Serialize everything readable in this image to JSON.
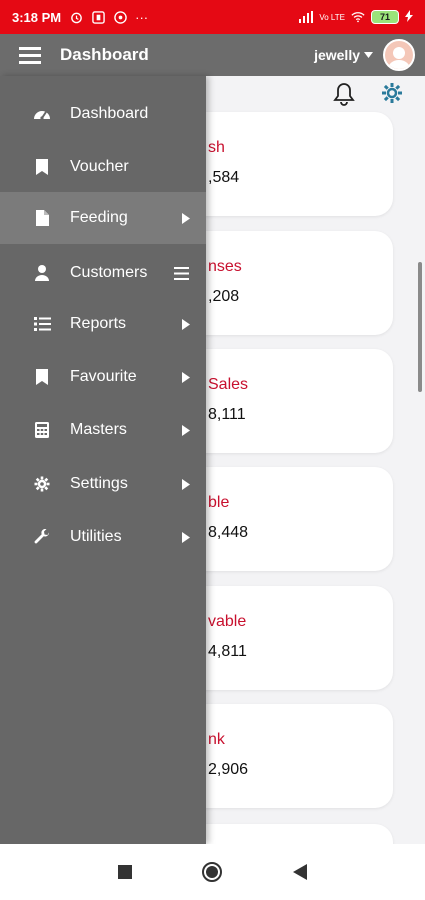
{
  "status_bar": {
    "time": "3:18 PM",
    "dots": "···",
    "battery": "71",
    "network": "Vo LTE"
  },
  "header": {
    "title": "Dashboard",
    "user": "jewelly"
  },
  "drawer": {
    "items": [
      {
        "label": "Dashboard",
        "icon": "speedometer-icon",
        "arrow": false
      },
      {
        "label": "Voucher",
        "icon": "bookmark-icon",
        "arrow": false
      },
      {
        "label": "Feeding",
        "icon": "file-icon",
        "arrow": true,
        "active": true
      },
      {
        "label": "Customers",
        "icon": "person-icon",
        "arrow": false
      },
      {
        "label": "Reports",
        "icon": "list-icon",
        "arrow": true
      },
      {
        "label": "Favourite",
        "icon": "bookmark-icon",
        "arrow": true
      },
      {
        "label": "Masters",
        "icon": "calculator-icon",
        "arrow": true
      },
      {
        "label": "Settings",
        "icon": "gear-icon",
        "arrow": true
      },
      {
        "label": "Utilities",
        "icon": "wrench-icon",
        "arrow": true
      }
    ]
  },
  "cards": [
    {
      "title": "sh",
      "value": ",584"
    },
    {
      "title": "nses",
      "value": ",208"
    },
    {
      "title": "Sales",
      "value": "8,111"
    },
    {
      "title": "ble",
      "value": "8,448"
    },
    {
      "title": "vable",
      "value": "4,811"
    },
    {
      "title": "nk",
      "value": "2,906"
    }
  ],
  "colors": {
    "status_bar": "#e50914",
    "drawer": "#676767",
    "accent_text": "#c8102e"
  }
}
